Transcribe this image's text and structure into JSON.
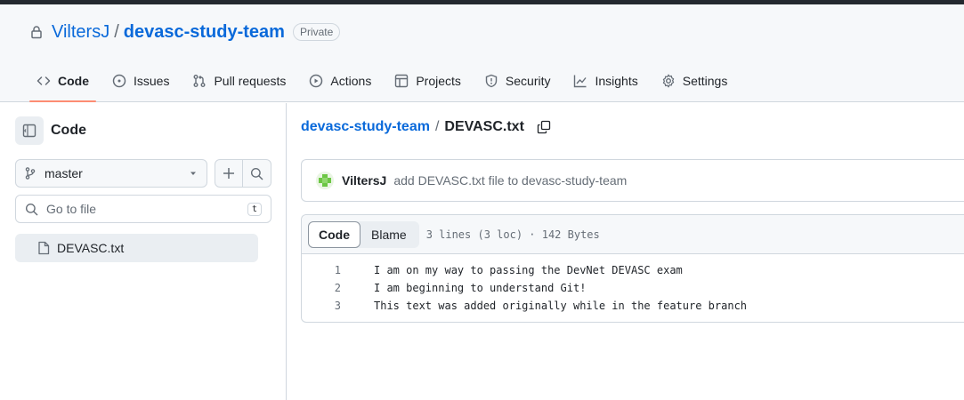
{
  "repo": {
    "owner": "ViltersJ",
    "separator": "/",
    "name": "devasc-study-team",
    "visibility": "Private"
  },
  "nav": {
    "tabs": [
      {
        "label": "Code",
        "icon": "code-icon",
        "active": true
      },
      {
        "label": "Issues",
        "icon": "issue-icon"
      },
      {
        "label": "Pull requests",
        "icon": "pull-request-icon"
      },
      {
        "label": "Actions",
        "icon": "play-icon"
      },
      {
        "label": "Projects",
        "icon": "table-icon"
      },
      {
        "label": "Security",
        "icon": "shield-icon"
      },
      {
        "label": "Insights",
        "icon": "graph-icon"
      },
      {
        "label": "Settings",
        "icon": "gear-icon"
      }
    ]
  },
  "sidebar": {
    "title": "Code",
    "branch": "master",
    "goto_placeholder": "Go to file",
    "goto_shortcut": "t",
    "files": [
      {
        "name": "DEVASC.txt"
      }
    ]
  },
  "breadcrumb": {
    "repo_link": "devasc-study-team",
    "separator": "/",
    "file": "DEVASC.txt"
  },
  "commit": {
    "author": "ViltersJ",
    "message": "add DEVASC.txt file to devasc-study-team"
  },
  "file": {
    "code_tab": "Code",
    "blame_tab": "Blame",
    "meta": "3 lines (3 loc) · 142 Bytes",
    "lines": [
      {
        "num": "1",
        "text": "I am on my way to passing the DevNet DEVASC exam"
      },
      {
        "num": "2",
        "text": "I am beginning to understand Git!"
      },
      {
        "num": "3",
        "text": "This text was added originally while in the feature branch"
      }
    ]
  },
  "colors": {
    "link": "#0969da",
    "active_tab_underline": "#fd8c73",
    "muted_text": "#656d76",
    "border": "#d0d7de"
  }
}
